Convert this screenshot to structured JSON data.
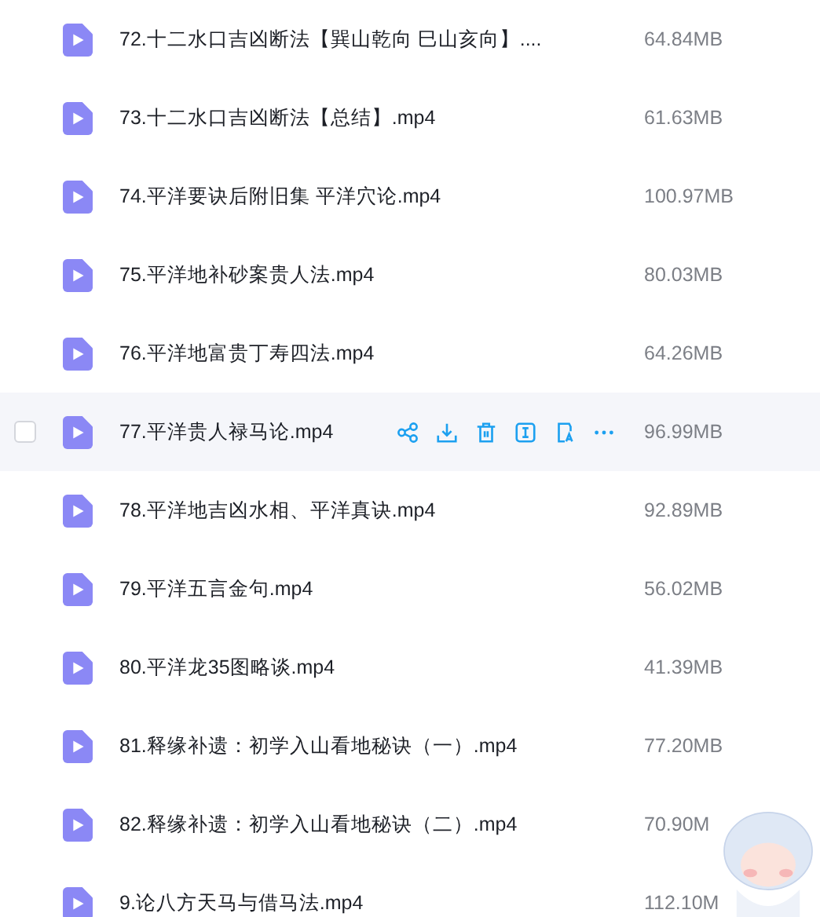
{
  "files": [
    {
      "name": "72.十二水口吉凶断法【巽山乾向 巳山亥向】....",
      "size": "64.84MB",
      "hovered": false
    },
    {
      "name": "73.十二水口吉凶断法【总结】.mp4",
      "size": "61.63MB",
      "hovered": false
    },
    {
      "name": "74.平洋要诀后附旧集 平洋穴论.mp4",
      "size": "100.97MB",
      "hovered": false
    },
    {
      "name": "75.平洋地补砂案贵人法.mp4",
      "size": "80.03MB",
      "hovered": false
    },
    {
      "name": "76.平洋地富贵丁寿四法.mp4",
      "size": "64.26MB",
      "hovered": false
    },
    {
      "name": "77.平洋贵人禄马论.mp4",
      "size": "96.99MB",
      "hovered": true,
      "checked": false
    },
    {
      "name": "78.平洋地吉凶水相、平洋真诀.mp4",
      "size": "92.89MB",
      "hovered": false
    },
    {
      "name": "79.平洋五言金句.mp4",
      "size": "56.02MB",
      "hovered": false
    },
    {
      "name": "80.平洋龙35图略谈.mp4",
      "size": "41.39MB",
      "hovered": false
    },
    {
      "name": "81.释缘补遗：初学入山看地秘诀（一）.mp4",
      "size": "77.20MB",
      "hovered": false
    },
    {
      "name": "82.释缘补遗：初学入山看地秘诀（二）.mp4",
      "size": "70.90M",
      "hovered": false
    },
    {
      "name": "9.论八方天马与借马法.mp4",
      "size": "112.10M",
      "hovered": false
    }
  ]
}
